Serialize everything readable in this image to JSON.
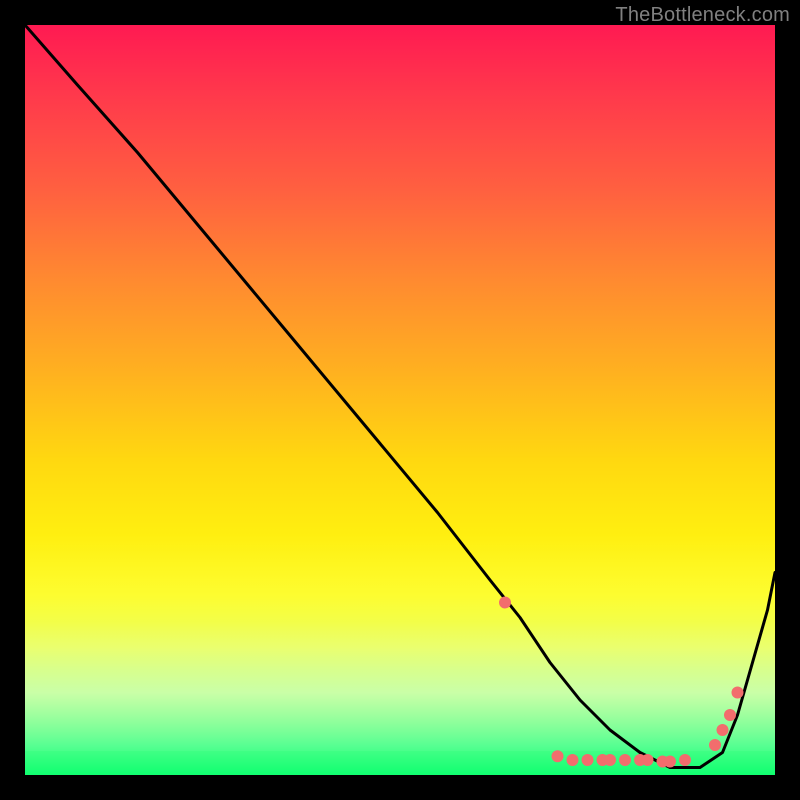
{
  "watermark": "TheBottleneck.com",
  "chart_data": {
    "type": "line",
    "title": "",
    "xlabel": "",
    "ylabel": "",
    "xlim": [
      0,
      100
    ],
    "ylim": [
      0,
      100
    ],
    "grid": false,
    "annotations": [],
    "series": [
      {
        "name": "curve",
        "color": "#000000",
        "x": [
          0,
          7,
          15,
          25,
          35,
          45,
          55,
          62,
          66,
          70,
          74,
          78,
          82,
          86,
          90,
          93,
          95,
          97,
          99,
          100
        ],
        "y": [
          100,
          92,
          83,
          71,
          59,
          47,
          35,
          26,
          21,
          15,
          10,
          6,
          3,
          1,
          1,
          3,
          8,
          15,
          22,
          27
        ]
      }
    ],
    "markers": {
      "name": "highlight-points",
      "color": "#f26d6d",
      "radius": 6,
      "x": [
        64,
        71,
        73,
        75,
        77,
        78,
        80,
        82,
        83,
        85,
        86,
        88,
        92,
        93,
        94,
        95
      ],
      "y": [
        23,
        2.5,
        2,
        2,
        2,
        2,
        2,
        2,
        2,
        1.8,
        1.8,
        2,
        4,
        6,
        8,
        11
      ]
    }
  }
}
